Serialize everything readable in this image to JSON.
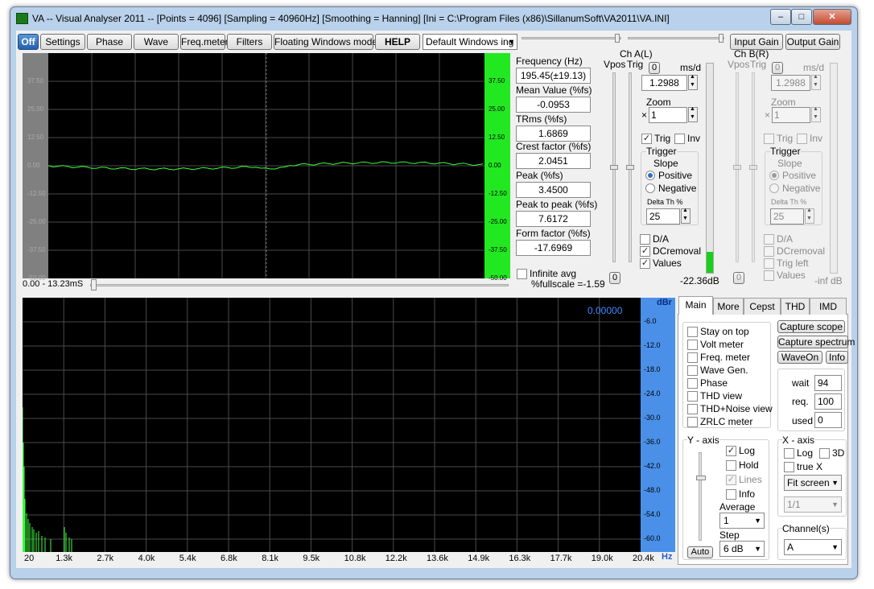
{
  "window": {
    "title": "VA -- Visual Analyser 2011 --  [Points = 4096]  [Sampling = 40960Hz]  [Smoothing = Hanning]  [Ini = C:\\Program Files (x86)\\SillanumSoft\\VA2011\\VA.INI]",
    "minimize": "–",
    "maximize": "□",
    "close": "✕"
  },
  "toolbar": {
    "off": "Off",
    "settings": "Settings",
    "phase": "Phase",
    "wave": "Wave",
    "freqmeter": "Freq.meter",
    "filters": "Filters",
    "floating": "Floating Windows mode",
    "help": "HELP",
    "windows_mode": "Default Windows ing",
    "input_gain": "Input Gain",
    "output_gain": "Output Gain"
  },
  "scope": {
    "y_ticks_left": [
      "37.50",
      "25.00",
      "12.50",
      "0.00",
      "-12.50",
      "-25.00",
      "-37.50",
      "-50.00"
    ],
    "y_ticks_right": [
      "37.50",
      "25.00",
      "12.50",
      "0.00",
      "-12.50",
      "-25.00",
      "-37.50",
      "-50.00"
    ],
    "time_range": "0.00 - 13.23mS"
  },
  "measurements": {
    "frequency_label": "Frequency (Hz)",
    "frequency": "195.45(±19.13)",
    "mean_label": "Mean Value (%fs)",
    "mean": "-0.0953",
    "trms_label": "TRms (%fs)",
    "trms": "1.6869",
    "crest_label": "Crest factor (%fs)",
    "crest": "2.0451",
    "peak_label": "Peak (%fs)",
    "peak": "3.4500",
    "p2p_label": "Peak to peak (%fs)",
    "p2p": "7.6172",
    "form_label": "Form factor (%fs)",
    "form": "-17.6969",
    "infinite_avg": "Infinite avg",
    "fullscale": "%fullscale =-1.59"
  },
  "chA": {
    "title": "Ch A(L)",
    "vpos": "Vpos",
    "trig_label": "Trig",
    "ms_d": "ms/d",
    "zero": "0",
    "ms_value": "1.2988",
    "zoom_label": "Zoom",
    "x": "×",
    "zoom_value": "1",
    "trig": "Trig",
    "inv": "Inv",
    "trigger_title": "Trigger",
    "slope": "Slope",
    "positive": "Positive",
    "negative": "Negative",
    "delta": "Delta Th %",
    "delta_value": "25",
    "da": "D/A",
    "dcremoval": "DCremoval",
    "values": "Values",
    "bottom_zero": "0",
    "level": "-22.36dB",
    "level_fill": 0.1
  },
  "chB": {
    "title": "Ch B(R)",
    "vpos": "Vpos",
    "trig_label": "Trig",
    "ms_d": "ms/d",
    "zero": "0",
    "ms_value": "1.2988",
    "zoom_label": "Zoom",
    "x": "×",
    "zoom_value": "1",
    "trig": "Trig",
    "inv": "Inv",
    "trigger_title": "Trigger",
    "slope": "Slope",
    "positive": "Positive",
    "negative": "Negative",
    "delta": "Delta Th %",
    "delta_value": "25",
    "da": "D/A",
    "dcremoval": "DCremoval",
    "trig_left": "Trig left",
    "values": "Values",
    "bottom_zero": "0",
    "level": "-inf dB"
  },
  "spectrum": {
    "value": "0.00000",
    "unit_y": "dBr",
    "unit_x": "Hz",
    "y_ticks": [
      "-6.0",
      "-12.0",
      "-18.0",
      "-24.0",
      "-30.0",
      "-36.0",
      "-42.0",
      "-48.0",
      "-54.0",
      "-60.0"
    ],
    "x_ticks": [
      "20",
      "1.3k",
      "2.7k",
      "4.0k",
      "5.4k",
      "6.8k",
      "8.1k",
      "9.5k",
      "10.8k",
      "12.2k",
      "13.6k",
      "14.9k",
      "16.3k",
      "17.7k",
      "19.0k",
      "20.4k"
    ]
  },
  "tabs": [
    "Main",
    "More",
    "Cepst",
    "THD",
    "IMD"
  ],
  "main": {
    "stay_on_top": "Stay on top",
    "volt_meter": "Volt meter",
    "freq_meter": "Freq. meter",
    "wave_gen": "Wave Gen.",
    "phase": "Phase",
    "thd_view": "THD view",
    "thd_noise": "THD+Noise view",
    "zrlc": "ZRLC meter",
    "capture_scope": "Capture scope",
    "capture_spectrum": "Capture spectrum",
    "waveon": "WaveOn",
    "info": "Info",
    "wait_label": "wait",
    "wait": "94",
    "req_label": "req.",
    "req": "100",
    "used_label": "used",
    "used": "0",
    "y_axis": "Y - axis",
    "log": "Log",
    "hold": "Hold",
    "lines": "Lines",
    "y_info": "Info",
    "average_label": "Average",
    "average": "1",
    "step_label": "Step",
    "step": "6 dB",
    "auto": "Auto",
    "x_axis": "X - axis",
    "x_log": "Log",
    "x_3d": "3D",
    "true_x": "true X",
    "fit": "Fit screen",
    "ratio": "1/1",
    "channels_label": "Channel(s)",
    "channel": "A"
  },
  "colors": {
    "scope_bg": "#000000",
    "grid": "#4a4a4a",
    "trace": "#3cff3c",
    "level_bar": "#00ee00",
    "spec_axis": "#4a90e8",
    "title_bg": "#b9d1ea"
  }
}
